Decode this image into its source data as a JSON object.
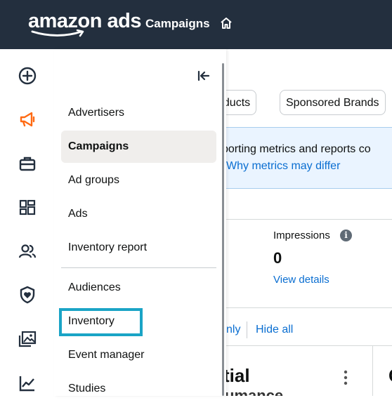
{
  "header": {
    "logo_text": "amazon ads",
    "title": "Campaigns",
    "home_icon": "home-icon"
  },
  "rail": {
    "icons": [
      "plus-circle-icon",
      "megaphone-icon",
      "briefcase-icon",
      "dashboard-icon",
      "people-icon",
      "shield-icon",
      "images-icon",
      "chart-line-icon"
    ],
    "active_color": "#ff6a13"
  },
  "menu": {
    "items": [
      {
        "label": "Advertisers",
        "active": false
      },
      {
        "label": "Campaigns",
        "active": true
      },
      {
        "label": "Ad groups",
        "active": false
      },
      {
        "label": "Ads",
        "active": false
      },
      {
        "label": "Inventory report",
        "active": false
      },
      {
        "label": "Audiences",
        "active": false
      },
      {
        "label": "Inventory",
        "active": false,
        "highlighted": true
      },
      {
        "label": "Event manager",
        "active": false
      },
      {
        "label": "Studies",
        "active": false
      }
    ]
  },
  "background": {
    "chips": [
      "oducts",
      "Sponsored Brands"
    ],
    "banner_text": "porting metrics and reports co",
    "banner_link": "Why metrics may differ",
    "metric": {
      "label": "Impressions",
      "value": "0",
      "link": "View details"
    },
    "links": {
      "only": "nly",
      "hide_all": "Hide all"
    },
    "card_title": "tial",
    "card_title_2": "umance",
    "card_edge": "C"
  },
  "colors": {
    "topbar": "#232f3e",
    "link": "#0a6ed1",
    "highlight": "#1aa4c6"
  }
}
